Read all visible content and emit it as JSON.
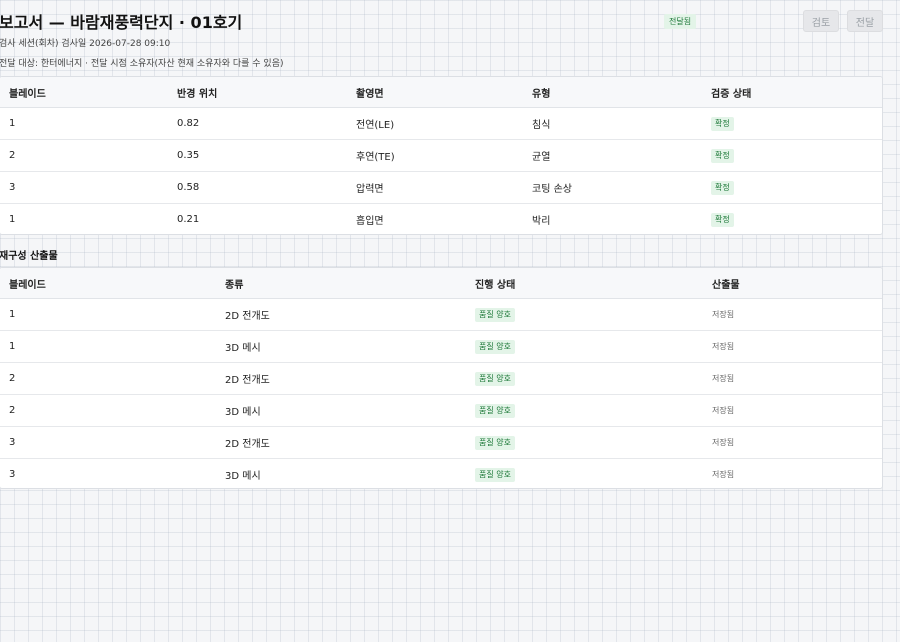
{
  "header": {
    "title": "보고서 — 바람재풍력단지 · 01호기",
    "session_line": "검사 세션(회차) 검사일 2026-07-28 09:10",
    "recipient_line": "전달 대상: 한터에너지 · 전달 시점 소유자(자산 현재 소유자와 다를 수 있음)",
    "status_chip": "전달됨",
    "review_button": "검토",
    "send_button": "전달"
  },
  "findings": {
    "columns": [
      "블레이드",
      "반경 위치",
      "촬영면",
      "유형",
      "검증 상태"
    ],
    "rows": [
      [
        "1",
        "0.82",
        "전연(LE)",
        "침식",
        "확정"
      ],
      [
        "2",
        "0.35",
        "후연(TE)",
        "균열",
        "확정"
      ],
      [
        "3",
        "0.58",
        "압력면",
        "코팅 손상",
        "확정"
      ],
      [
        "1",
        "0.21",
        "흡입면",
        "박리",
        "확정"
      ]
    ]
  },
  "reconstruction": {
    "title": "재구성 산출물",
    "columns": [
      "블레이드",
      "종류",
      "진행 상태",
      "산출물"
    ],
    "rows": [
      [
        "1",
        "2D 전개도",
        "품질 양호",
        "저장됨"
      ],
      [
        "1",
        "3D 메시",
        "품질 양호",
        "저장됨"
      ],
      [
        "2",
        "2D 전개도",
        "품질 양호",
        "저장됨"
      ],
      [
        "2",
        "3D 메시",
        "품질 양호",
        "저장됨"
      ],
      [
        "3",
        "2D 전개도",
        "품질 양호",
        "저장됨"
      ],
      [
        "3",
        "3D 메시",
        "품질 양호",
        "저장됨"
      ]
    ]
  },
  "colors": {
    "badge_bg": "#e3f4e8",
    "badge_text": "#1f7a3a",
    "disabled_button_bg": "#e6e7ea"
  }
}
